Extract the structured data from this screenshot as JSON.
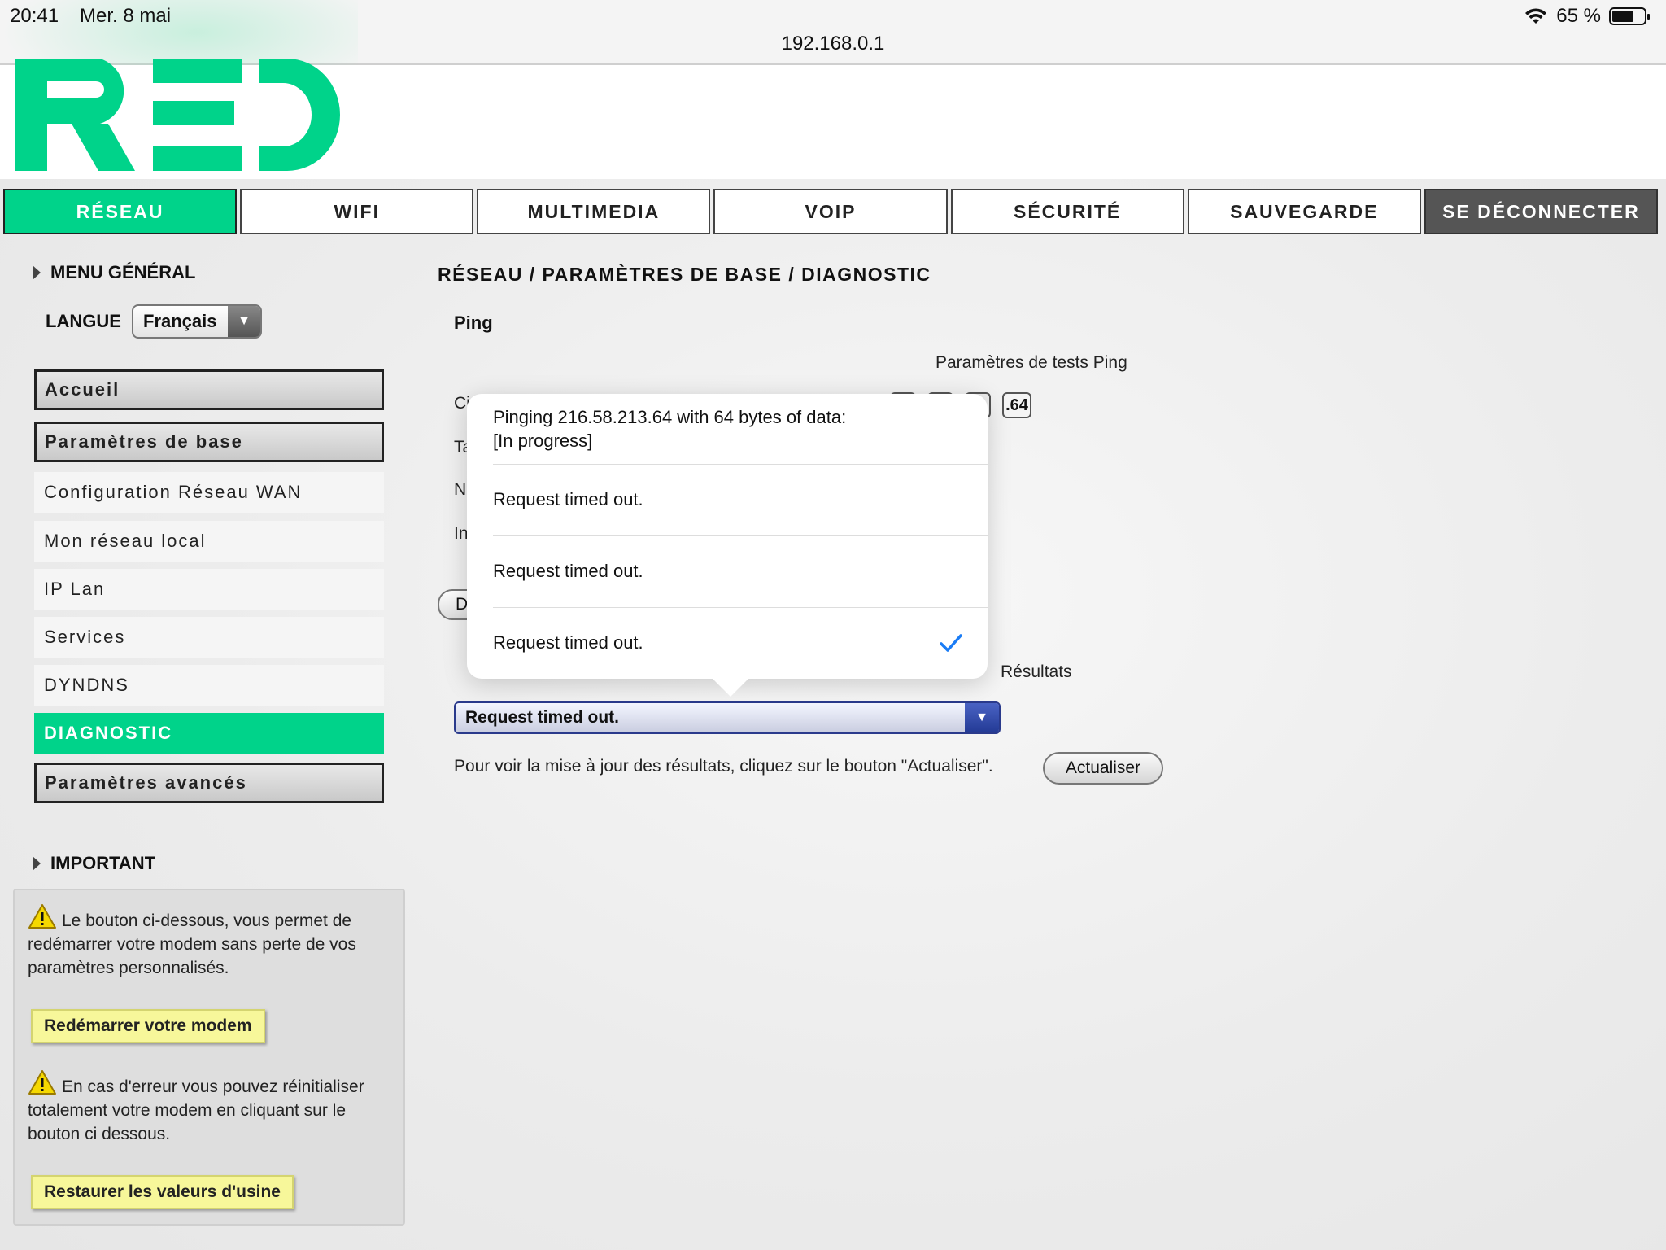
{
  "status_bar": {
    "time": "20:41",
    "date": "Mer. 8 mai",
    "url": "192.168.0.1",
    "battery": "65 %",
    "icons": [
      "wifi-icon",
      "battery-icon"
    ]
  },
  "brand": {
    "accent_color": "#00d38a",
    "dark_tab_color": "#555555"
  },
  "nav": {
    "tabs": [
      {
        "label": "RÉSEAU",
        "state": "active"
      },
      {
        "label": "WIFI",
        "state": "normal"
      },
      {
        "label": "MULTIMEDIA",
        "state": "normal"
      },
      {
        "label": "VOIP",
        "state": "normal"
      },
      {
        "label": "SÉCURITÉ",
        "state": "normal"
      },
      {
        "label": "SAUVEGARDE",
        "state": "normal"
      },
      {
        "label": "SE DÉCONNECTER",
        "state": "dark"
      }
    ]
  },
  "sidebar": {
    "menu_heading": "MENU GÉNÉRAL",
    "language_label": "LANGUE",
    "language_value": "Français",
    "items": [
      {
        "label": "Accueil",
        "style": "framed"
      },
      {
        "label": "Paramètres de base",
        "style": "framed"
      },
      {
        "label": "Configuration Réseau WAN",
        "style": "plain"
      },
      {
        "label": "Mon réseau local",
        "style": "plain"
      },
      {
        "label": "IP Lan",
        "style": "plain"
      },
      {
        "label": "Services",
        "style": "plain"
      },
      {
        "label": "DYNDNS",
        "style": "plain"
      },
      {
        "label": "DIAGNOSTIC",
        "style": "active"
      },
      {
        "label": "Paramètres avancés",
        "style": "framed"
      }
    ],
    "important_heading": "IMPORTANT",
    "important": {
      "text1": "Le bouton ci-dessous, vous permet de redémarrer votre modem sans perte de vos paramètres personnalisés.",
      "button1": "Redémarrer votre modem",
      "text2": "En cas d'erreur vous pouvez réinitialiser totalement votre modem en cliquant sur le bouton ci dessous.",
      "button2": "Restaurer les valeurs d'usine"
    }
  },
  "main": {
    "breadcrumb": "RÉSEAU / PARAMÈTRES DE BASE / DIAGNOSTIC",
    "section_title": "Ping",
    "params_title": "Paramètres de tests Ping",
    "row_labels_visible": [
      "Ci",
      "Ta",
      "N",
      "In"
    ],
    "ip_last_octet": ".64",
    "button_partial": "D",
    "results_label": "Résultats",
    "results_selected": "Request timed out.",
    "refresh_hint": "Pour voir la mise à jour des résultats, cliquez sur le bouton \"Actualiser\".",
    "refresh_button": "Actualiser"
  },
  "picker": {
    "header_line1": "Pinging 216.58.213.64 with 64 bytes of data:",
    "header_line2": "[In progress]",
    "options": [
      {
        "label": "Request timed out.",
        "selected": false
      },
      {
        "label": "Request timed out.",
        "selected": false
      },
      {
        "label": "Request timed out.",
        "selected": true
      }
    ]
  }
}
